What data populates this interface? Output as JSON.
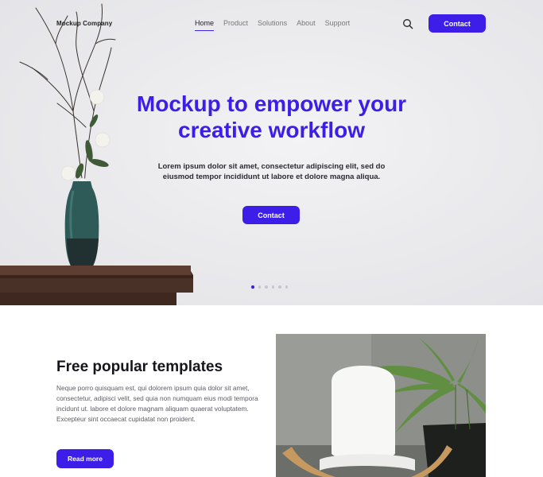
{
  "header": {
    "logo": "Mockup Company",
    "nav": [
      {
        "label": "Home",
        "active": true
      },
      {
        "label": "Product",
        "active": false
      },
      {
        "label": "Solutions",
        "active": false
      },
      {
        "label": "About",
        "active": false
      },
      {
        "label": "Support",
        "active": false
      }
    ],
    "search_icon": "search-icon",
    "contact_label": "Contact"
  },
  "hero": {
    "title_line1": "Mockup to empower your",
    "title_line2": "creative workflow",
    "subtitle": "Lorem ipsum dolor sit amet, consectetur adipiscing elit, sed do eiusmod tempor incididunt ut labore et dolore magna aliqua.",
    "cta_label": "Contact",
    "slides": 6,
    "active_slide": 1
  },
  "feature": {
    "title": "Free popular templates",
    "body": "Neque porro quisquam est, qui dolorem ipsum quia dolor sit amet, consectetur, adipisci velit, sed quia non numquam eius modi tempora incidunt ut. labore et dolore magnam aliquam quaerat voluptatem. Excepteur sint occaecat cupidatat non proident.",
    "cta_label": "Read more"
  },
  "colors": {
    "accent": "#3c1ee8",
    "hero_bg": "#ebebee",
    "text_dark": "#15151c",
    "text_muted": "#5c5c66"
  }
}
